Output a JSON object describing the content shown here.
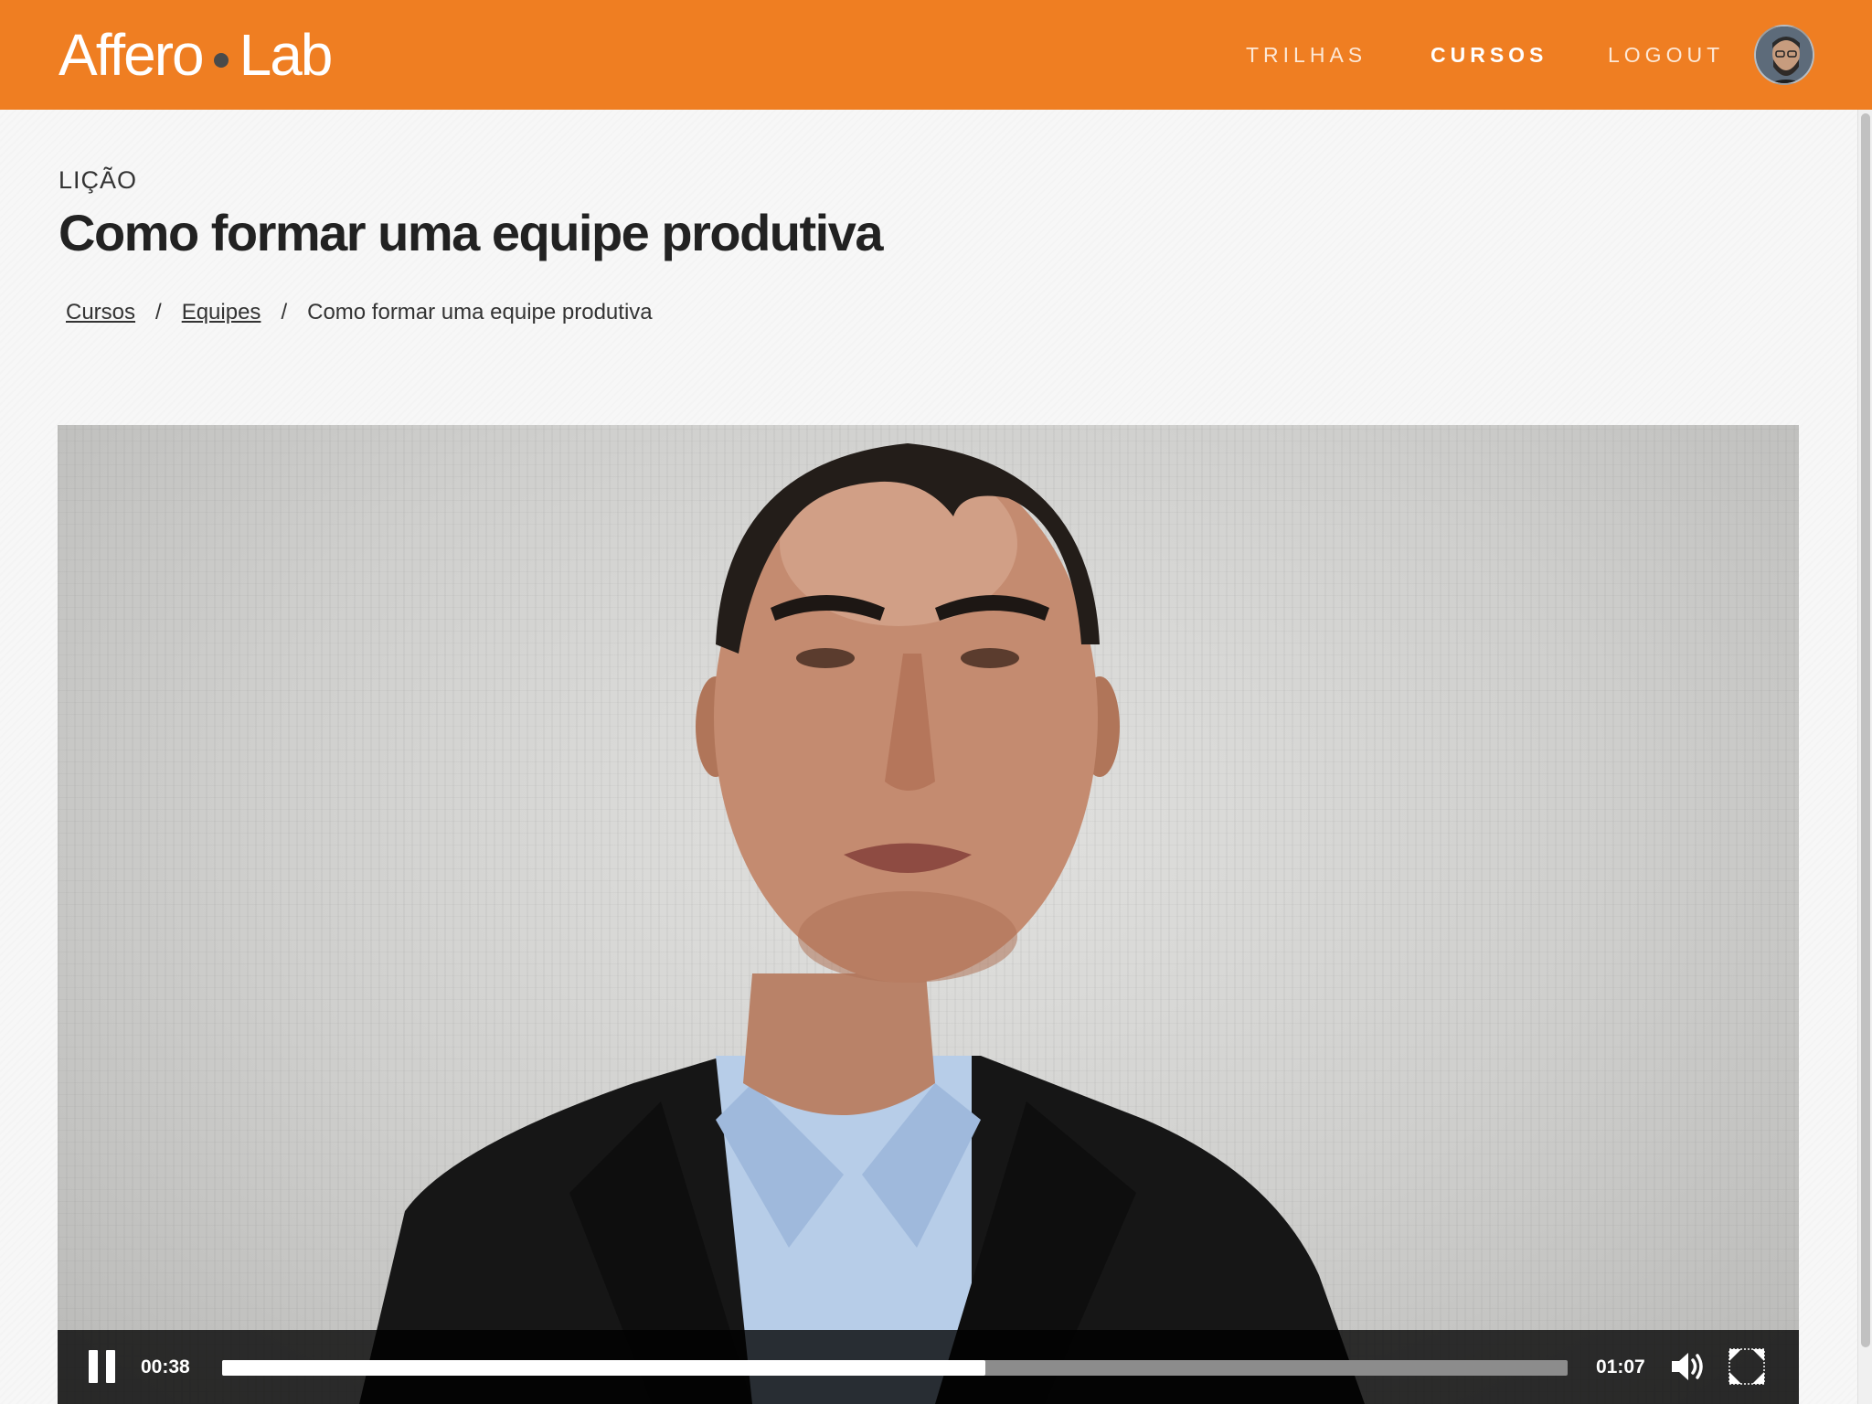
{
  "header": {
    "logo_left": "Affero",
    "logo_right": "Lab",
    "nav": {
      "trilhas": "TRILHAS",
      "cursos": "CURSOS",
      "logout": "LOGOUT"
    },
    "active_nav": "CURSOS",
    "brand_color": "#ef7e22"
  },
  "lesson": {
    "kicker": "LIÇÃO",
    "title": "Como formar uma equipe produtiva"
  },
  "breadcrumb": {
    "items": [
      "Cursos",
      "Equipes",
      "Como formar uma equipe produtiva"
    ],
    "separator": "/"
  },
  "player": {
    "current_time": "00:38",
    "total_time": "01:07",
    "progress": 0.567,
    "state": "playing",
    "icons": [
      "pause-icon",
      "volume-icon",
      "fullscreen-icon"
    ]
  }
}
